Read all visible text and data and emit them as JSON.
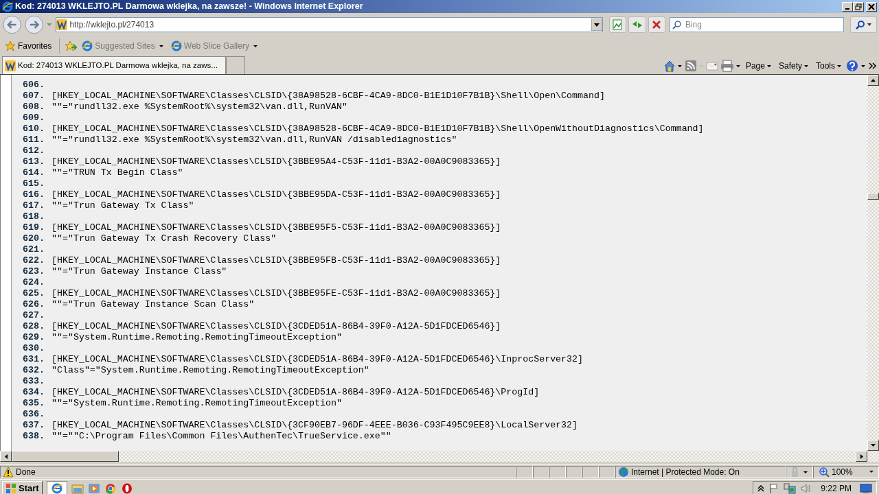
{
  "window": {
    "title": "Kod: 274013 WKLEJTO.PL Darmowa wklejka, na zawsze! - Windows Internet Explorer"
  },
  "address_bar": {
    "url": "http://wklejto.pl/274013"
  },
  "search": {
    "placeholder": "Bing"
  },
  "favorites_bar": {
    "label": "Favorites",
    "items": [
      "Suggested Sites",
      "Web Slice Gallery"
    ]
  },
  "tab": {
    "title": "Kod: 274013 WKLEJTO.PL Darmowa wklejka, na zaws..."
  },
  "command_bar": [
    "Page",
    "Safety",
    "Tools"
  ],
  "code_lines": [
    {
      "number": "606."
    },
    {
      "number": "607.",
      "text": "[HKEY_LOCAL_MACHINE\\SOFTWARE\\Classes\\CLSID\\{38A98528-6CBF-4CA9-8DC0-B1E1D10F7B1B}\\Shell\\Open\\Command]"
    },
    {
      "number": "608.",
      "text": "\"\"=\"rundll32.exe %SystemRoot%\\system32\\van.dll,RunVAN\""
    },
    {
      "number": "609."
    },
    {
      "number": "610.",
      "text": "[HKEY_LOCAL_MACHINE\\SOFTWARE\\Classes\\CLSID\\{38A98528-6CBF-4CA9-8DC0-B1E1D10F7B1B}\\Shell\\OpenWithoutDiagnostics\\Command]"
    },
    {
      "number": "611.",
      "text": "\"\"=\"rundll32.exe %SystemRoot%\\system32\\van.dll,RunVAN /disablediagnostics\""
    },
    {
      "number": "612."
    },
    {
      "number": "613.",
      "text": "[HKEY_LOCAL_MACHINE\\SOFTWARE\\Classes\\CLSID\\{3BBE95A4-C53F-11d1-B3A2-00A0C9083365}]"
    },
    {
      "number": "614.",
      "text": "\"\"=\"TRUN Tx Begin Class\""
    },
    {
      "number": "615."
    },
    {
      "number": "616.",
      "text": "[HKEY_LOCAL_MACHINE\\SOFTWARE\\Classes\\CLSID\\{3BBE95DA-C53F-11d1-B3A2-00A0C9083365}]"
    },
    {
      "number": "617.",
      "text": "\"\"=\"Trun Gateway Tx Class\""
    },
    {
      "number": "618."
    },
    {
      "number": "619.",
      "text": "[HKEY_LOCAL_MACHINE\\SOFTWARE\\Classes\\CLSID\\{3BBE95F5-C53F-11d1-B3A2-00A0C9083365}]"
    },
    {
      "number": "620.",
      "text": "\"\"=\"Trun Gateway Tx Crash Recovery Class\""
    },
    {
      "number": "621."
    },
    {
      "number": "622.",
      "text": "[HKEY_LOCAL_MACHINE\\SOFTWARE\\Classes\\CLSID\\{3BBE95FB-C53F-11d1-B3A2-00A0C9083365}]"
    },
    {
      "number": "623.",
      "text": "\"\"=\"Trun Gateway Instance Class\""
    },
    {
      "number": "624."
    },
    {
      "number": "625.",
      "text": "[HKEY_LOCAL_MACHINE\\SOFTWARE\\Classes\\CLSID\\{3BBE95FE-C53F-11d1-B3A2-00A0C9083365}]"
    },
    {
      "number": "626.",
      "text": "\"\"=\"Trun Gateway Instance Scan Class\""
    },
    {
      "number": "627."
    },
    {
      "number": "628.",
      "text": "[HKEY_LOCAL_MACHINE\\SOFTWARE\\Classes\\CLSID\\{3CDED51A-86B4-39F0-A12A-5D1FDCED6546}]"
    },
    {
      "number": "629.",
      "text": "\"\"=\"System.Runtime.Remoting.RemotingTimeoutException\""
    },
    {
      "number": "630."
    },
    {
      "number": "631.",
      "text": "[HKEY_LOCAL_MACHINE\\SOFTWARE\\Classes\\CLSID\\{3CDED51A-86B4-39F0-A12A-5D1FDCED6546}\\InprocServer32]"
    },
    {
      "number": "632.",
      "text": "\"Class\"=\"System.Runtime.Remoting.RemotingTimeoutException\""
    },
    {
      "number": "633."
    },
    {
      "number": "634.",
      "text": "[HKEY_LOCAL_MACHINE\\SOFTWARE\\Classes\\CLSID\\{3CDED51A-86B4-39F0-A12A-5D1FDCED6546}\\ProgId]"
    },
    {
      "number": "635.",
      "text": "\"\"=\"System.Runtime.Remoting.RemotingTimeoutException\""
    },
    {
      "number": "636."
    },
    {
      "number": "637.",
      "text": "[HKEY_LOCAL_MACHINE\\SOFTWARE\\Classes\\CLSID\\{3CF90EB7-96DF-4EEE-B036-C93F495C9EE8}\\LocalServer32]"
    },
    {
      "number": "638.",
      "text": "\"\"=\"\"C:\\Program Files\\Common Files\\AuthenTec\\TrueService.exe\"\""
    }
  ],
  "status_bar": {
    "text": "Done",
    "zone": "Internet | Protected Mode: On",
    "zoom": "100%"
  },
  "taskbar": {
    "start": "Start",
    "clock": "9:22 PM"
  }
}
